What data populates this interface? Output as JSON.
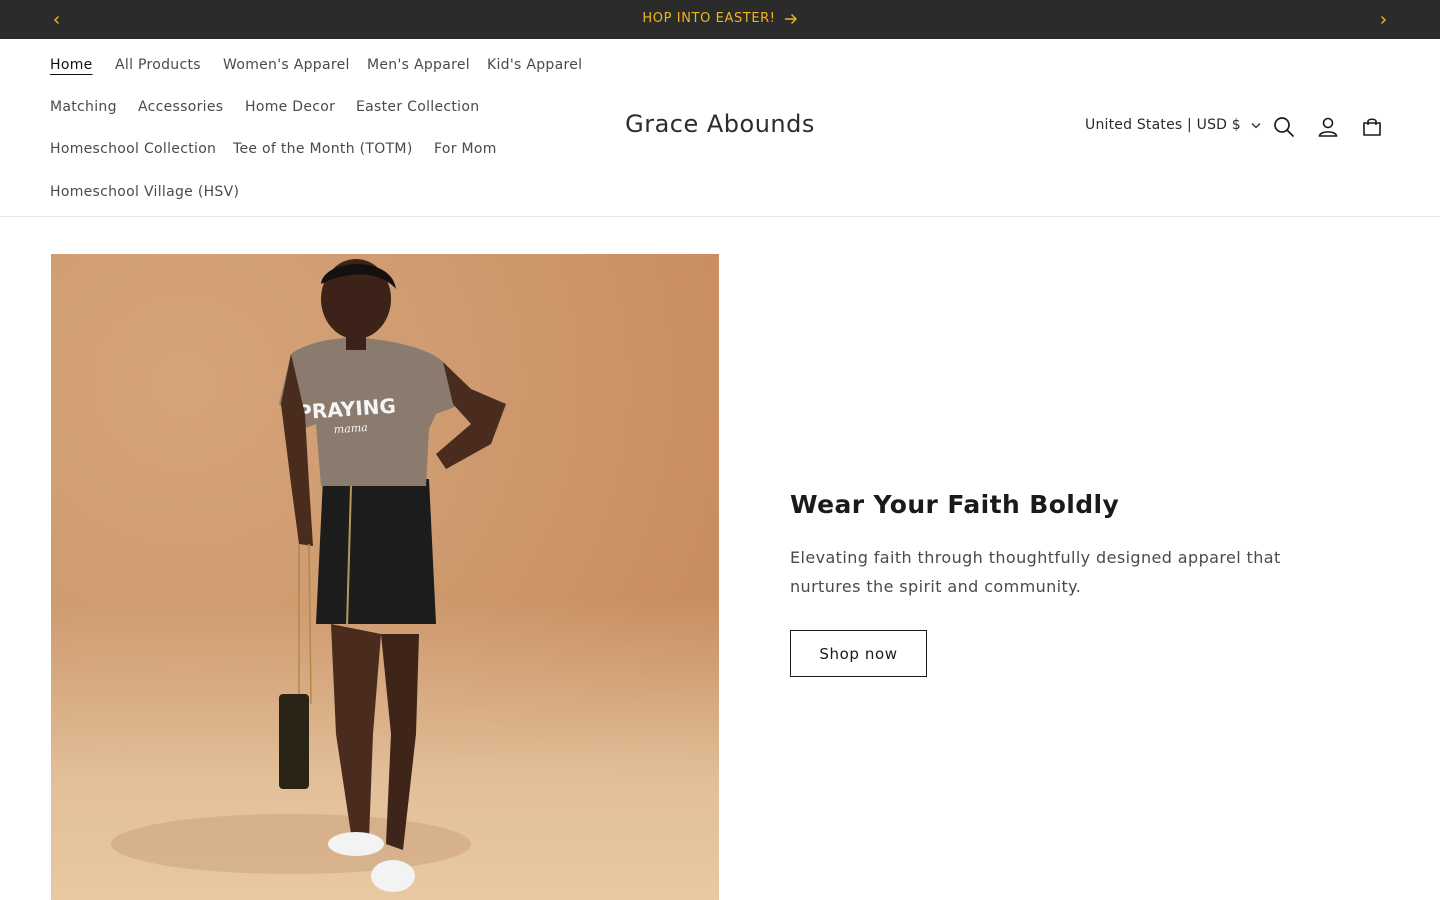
{
  "announcement": {
    "message": "HOP INTO EASTER!",
    "text_color": "#f0b421",
    "bar_color": "#2b2b2b",
    "prev_icon": "chevron-left-icon",
    "next_icon": "chevron-right-icon",
    "message_icon": "arrow-right-icon"
  },
  "header": {
    "brand": "Grace Abounds",
    "nav": [
      {
        "label": "Home",
        "active": true
      },
      {
        "label": "All Products"
      },
      {
        "label": "Women's Apparel"
      },
      {
        "label": "Men's Apparel"
      },
      {
        "label": "Kid's Apparel"
      },
      {
        "label": "Matching"
      },
      {
        "label": "Accessories"
      },
      {
        "label": "Home Decor"
      },
      {
        "label": "Easter Collection"
      },
      {
        "label": "Homeschool Collection"
      },
      {
        "label": "Tee of the Month (TOTM)"
      },
      {
        "label": "For Mom"
      },
      {
        "label": "Homeschool Village (HSV)"
      }
    ],
    "country_selector": "United States | USD $",
    "icons": [
      "search-icon",
      "account-icon",
      "cart-icon"
    ]
  },
  "hero": {
    "heading": "Wear Your Faith Boldly",
    "text": "Elevating faith through thoughtfully designed apparel that nurtures the spirit and community.",
    "button_label": "Shop now",
    "image": {
      "shirt_text_line1": "PRAYING",
      "shirt_text_line2": "mama"
    }
  }
}
